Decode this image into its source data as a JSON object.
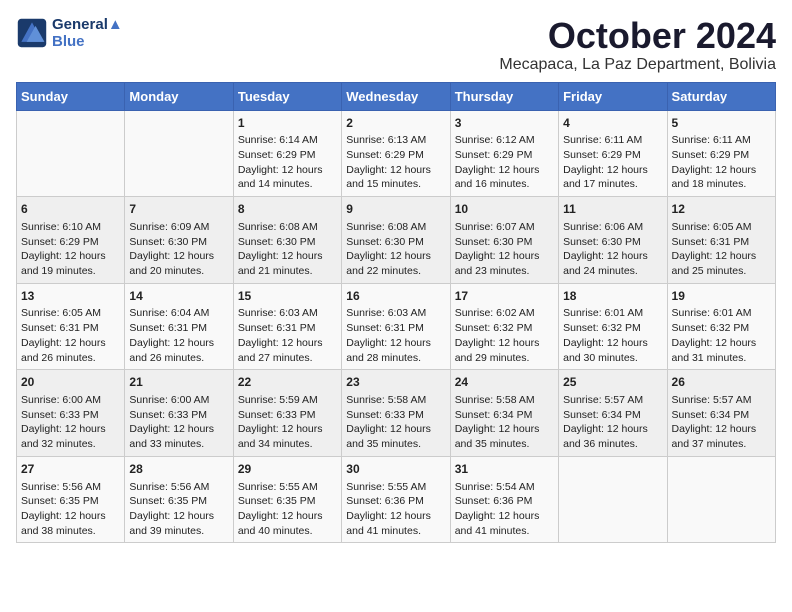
{
  "logo": {
    "line1": "General",
    "line2": "Blue"
  },
  "title": "October 2024",
  "location": "Mecapaca, La Paz Department, Bolivia",
  "days_of_week": [
    "Sunday",
    "Monday",
    "Tuesday",
    "Wednesday",
    "Thursday",
    "Friday",
    "Saturday"
  ],
  "weeks": [
    [
      {
        "day": "",
        "info": ""
      },
      {
        "day": "",
        "info": ""
      },
      {
        "day": "1",
        "info": "Sunrise: 6:14 AM\nSunset: 6:29 PM\nDaylight: 12 hours and 14 minutes."
      },
      {
        "day": "2",
        "info": "Sunrise: 6:13 AM\nSunset: 6:29 PM\nDaylight: 12 hours and 15 minutes."
      },
      {
        "day": "3",
        "info": "Sunrise: 6:12 AM\nSunset: 6:29 PM\nDaylight: 12 hours and 16 minutes."
      },
      {
        "day": "4",
        "info": "Sunrise: 6:11 AM\nSunset: 6:29 PM\nDaylight: 12 hours and 17 minutes."
      },
      {
        "day": "5",
        "info": "Sunrise: 6:11 AM\nSunset: 6:29 PM\nDaylight: 12 hours and 18 minutes."
      }
    ],
    [
      {
        "day": "6",
        "info": "Sunrise: 6:10 AM\nSunset: 6:29 PM\nDaylight: 12 hours and 19 minutes."
      },
      {
        "day": "7",
        "info": "Sunrise: 6:09 AM\nSunset: 6:30 PM\nDaylight: 12 hours and 20 minutes."
      },
      {
        "day": "8",
        "info": "Sunrise: 6:08 AM\nSunset: 6:30 PM\nDaylight: 12 hours and 21 minutes."
      },
      {
        "day": "9",
        "info": "Sunrise: 6:08 AM\nSunset: 6:30 PM\nDaylight: 12 hours and 22 minutes."
      },
      {
        "day": "10",
        "info": "Sunrise: 6:07 AM\nSunset: 6:30 PM\nDaylight: 12 hours and 23 minutes."
      },
      {
        "day": "11",
        "info": "Sunrise: 6:06 AM\nSunset: 6:30 PM\nDaylight: 12 hours and 24 minutes."
      },
      {
        "day": "12",
        "info": "Sunrise: 6:05 AM\nSunset: 6:31 PM\nDaylight: 12 hours and 25 minutes."
      }
    ],
    [
      {
        "day": "13",
        "info": "Sunrise: 6:05 AM\nSunset: 6:31 PM\nDaylight: 12 hours and 26 minutes."
      },
      {
        "day": "14",
        "info": "Sunrise: 6:04 AM\nSunset: 6:31 PM\nDaylight: 12 hours and 26 minutes."
      },
      {
        "day": "15",
        "info": "Sunrise: 6:03 AM\nSunset: 6:31 PM\nDaylight: 12 hours and 27 minutes."
      },
      {
        "day": "16",
        "info": "Sunrise: 6:03 AM\nSunset: 6:31 PM\nDaylight: 12 hours and 28 minutes."
      },
      {
        "day": "17",
        "info": "Sunrise: 6:02 AM\nSunset: 6:32 PM\nDaylight: 12 hours and 29 minutes."
      },
      {
        "day": "18",
        "info": "Sunrise: 6:01 AM\nSunset: 6:32 PM\nDaylight: 12 hours and 30 minutes."
      },
      {
        "day": "19",
        "info": "Sunrise: 6:01 AM\nSunset: 6:32 PM\nDaylight: 12 hours and 31 minutes."
      }
    ],
    [
      {
        "day": "20",
        "info": "Sunrise: 6:00 AM\nSunset: 6:33 PM\nDaylight: 12 hours and 32 minutes."
      },
      {
        "day": "21",
        "info": "Sunrise: 6:00 AM\nSunset: 6:33 PM\nDaylight: 12 hours and 33 minutes."
      },
      {
        "day": "22",
        "info": "Sunrise: 5:59 AM\nSunset: 6:33 PM\nDaylight: 12 hours and 34 minutes."
      },
      {
        "day": "23",
        "info": "Sunrise: 5:58 AM\nSunset: 6:33 PM\nDaylight: 12 hours and 35 minutes."
      },
      {
        "day": "24",
        "info": "Sunrise: 5:58 AM\nSunset: 6:34 PM\nDaylight: 12 hours and 35 minutes."
      },
      {
        "day": "25",
        "info": "Sunrise: 5:57 AM\nSunset: 6:34 PM\nDaylight: 12 hours and 36 minutes."
      },
      {
        "day": "26",
        "info": "Sunrise: 5:57 AM\nSunset: 6:34 PM\nDaylight: 12 hours and 37 minutes."
      }
    ],
    [
      {
        "day": "27",
        "info": "Sunrise: 5:56 AM\nSunset: 6:35 PM\nDaylight: 12 hours and 38 minutes."
      },
      {
        "day": "28",
        "info": "Sunrise: 5:56 AM\nSunset: 6:35 PM\nDaylight: 12 hours and 39 minutes."
      },
      {
        "day": "29",
        "info": "Sunrise: 5:55 AM\nSunset: 6:35 PM\nDaylight: 12 hours and 40 minutes."
      },
      {
        "day": "30",
        "info": "Sunrise: 5:55 AM\nSunset: 6:36 PM\nDaylight: 12 hours and 41 minutes."
      },
      {
        "day": "31",
        "info": "Sunrise: 5:54 AM\nSunset: 6:36 PM\nDaylight: 12 hours and 41 minutes."
      },
      {
        "day": "",
        "info": ""
      },
      {
        "day": "",
        "info": ""
      }
    ]
  ]
}
